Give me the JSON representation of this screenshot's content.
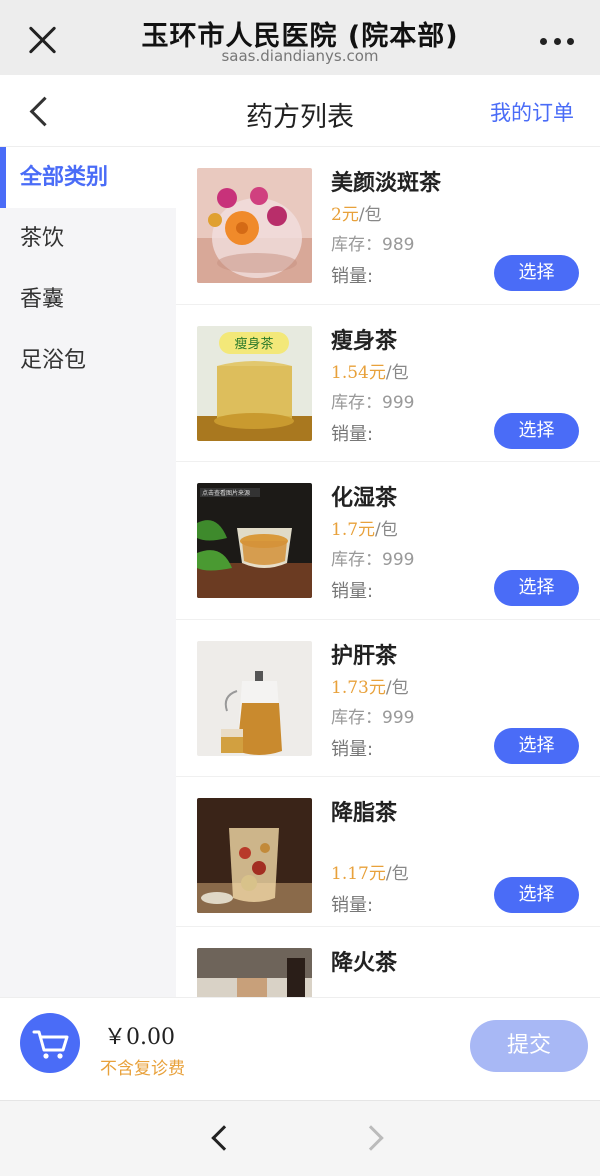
{
  "browser": {
    "title": "玉环市人民医院 (院本部)",
    "url": "saas.diandianys.com"
  },
  "header": {
    "title": "药方列表",
    "orders_link": "我的订单"
  },
  "sidebar": {
    "items": [
      {
        "label": "全部类别",
        "active": true
      },
      {
        "label": "茶饮",
        "active": false
      },
      {
        "label": "香囊",
        "active": false
      },
      {
        "label": "足浴包",
        "active": false
      }
    ]
  },
  "products": [
    {
      "name": "美颜淡斑茶",
      "price": "2元",
      "unit": "/包",
      "stock": "库存：989",
      "sales": "销量:",
      "button": "选择"
    },
    {
      "name": "瘦身茶",
      "price": "1.54元",
      "unit": "/包",
      "stock": "库存：999",
      "sales": "销量:",
      "button": "选择"
    },
    {
      "name": "化湿茶",
      "price": "1.7元",
      "unit": "/包",
      "stock": "库存：999",
      "sales": "销量:",
      "button": "选择"
    },
    {
      "name": "护肝茶",
      "price": "1.73元",
      "unit": "/包",
      "stock": "库存：999",
      "sales": "销量:",
      "button": "选择"
    },
    {
      "name": "降脂茶",
      "price": "1.17元",
      "unit": "/包",
      "stock": "",
      "sales": "销量:",
      "button": "选择"
    },
    {
      "name": "降火茶",
      "price": "",
      "unit": "",
      "stock": "",
      "sales": "",
      "button": ""
    }
  ],
  "thumb_labels": {
    "slimming": "瘦身茶",
    "dampness": "点击查看图片来源"
  },
  "cart": {
    "total": "￥0.00",
    "note": "不含复诊费",
    "submit_label": "提交"
  },
  "colors": {
    "accent": "#4a6cf7",
    "price": "#e8a13b",
    "submit_disabled": "#a8b8f5"
  }
}
